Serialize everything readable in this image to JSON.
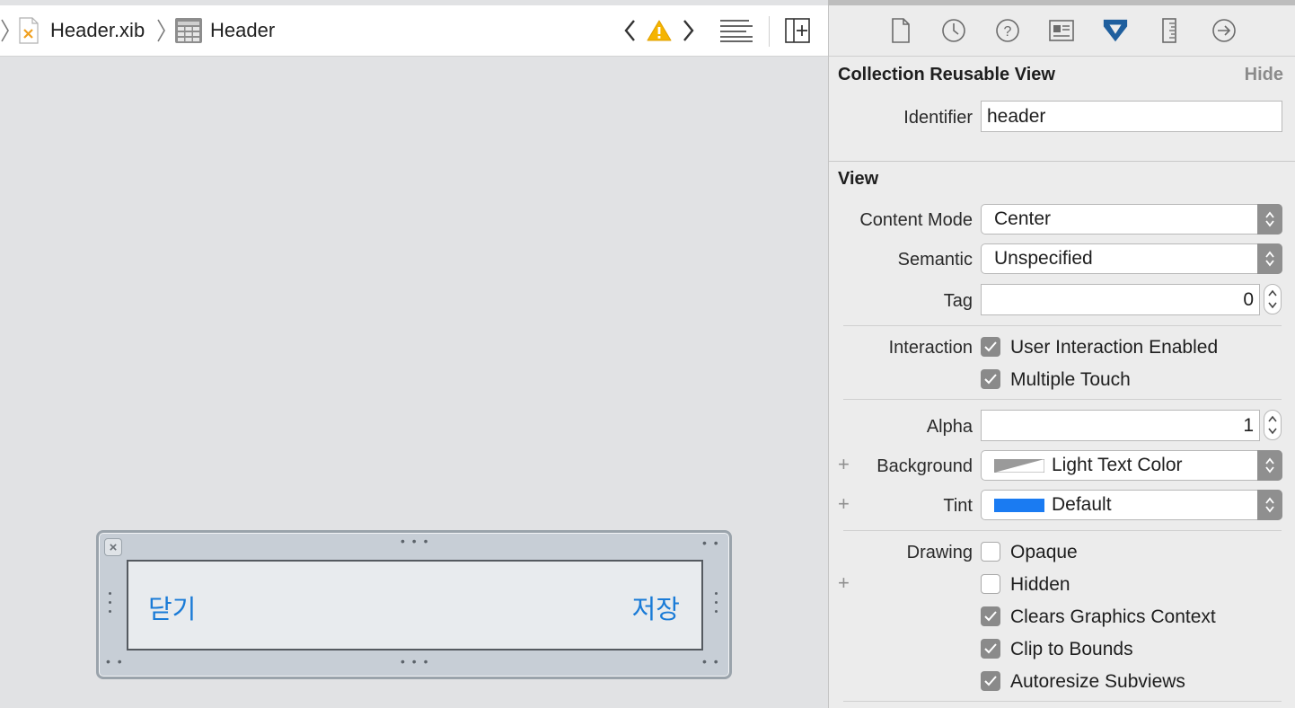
{
  "jumpbar": {
    "file_name": "Header.xib",
    "object_name": "Header"
  },
  "canvas": {
    "left_button": "닫기",
    "right_button": "저장",
    "link_color": "#1a7bd7"
  },
  "inspector": {
    "tabs": [
      "file-icon",
      "history-icon",
      "help-icon",
      "identity-icon",
      "attributes-icon",
      "size-icon",
      "connections-icon"
    ],
    "active_tab": "attributes-icon",
    "reusable_section": {
      "title": "Collection Reusable View",
      "hide_label": "Hide",
      "identifier_label": "Identifier",
      "identifier_value": "header"
    },
    "view_section": {
      "title": "View",
      "content_mode_label": "Content Mode",
      "content_mode_value": "Center",
      "semantic_label": "Semantic",
      "semantic_value": "Unspecified",
      "tag_label": "Tag",
      "tag_value": "0",
      "interaction_label": "Interaction",
      "user_interaction": {
        "label": "User Interaction Enabled",
        "checked": true
      },
      "multiple_touch": {
        "label": "Multiple Touch",
        "checked": true
      },
      "alpha_label": "Alpha",
      "alpha_value": "1",
      "background_label": "Background",
      "background_value": "Light Text Color",
      "tint_label": "Tint",
      "tint_value": "Default",
      "tint_color": "#1a7bf2",
      "drawing_label": "Drawing",
      "opaque": {
        "label": "Opaque",
        "checked": false
      },
      "hidden": {
        "label": "Hidden",
        "checked": false
      },
      "clears_graphics": {
        "label": "Clears Graphics Context",
        "checked": true
      },
      "clip_bounds": {
        "label": "Clip to Bounds",
        "checked": true
      },
      "autoresize": {
        "label": "Autoresize Subviews",
        "checked": true
      }
    }
  }
}
